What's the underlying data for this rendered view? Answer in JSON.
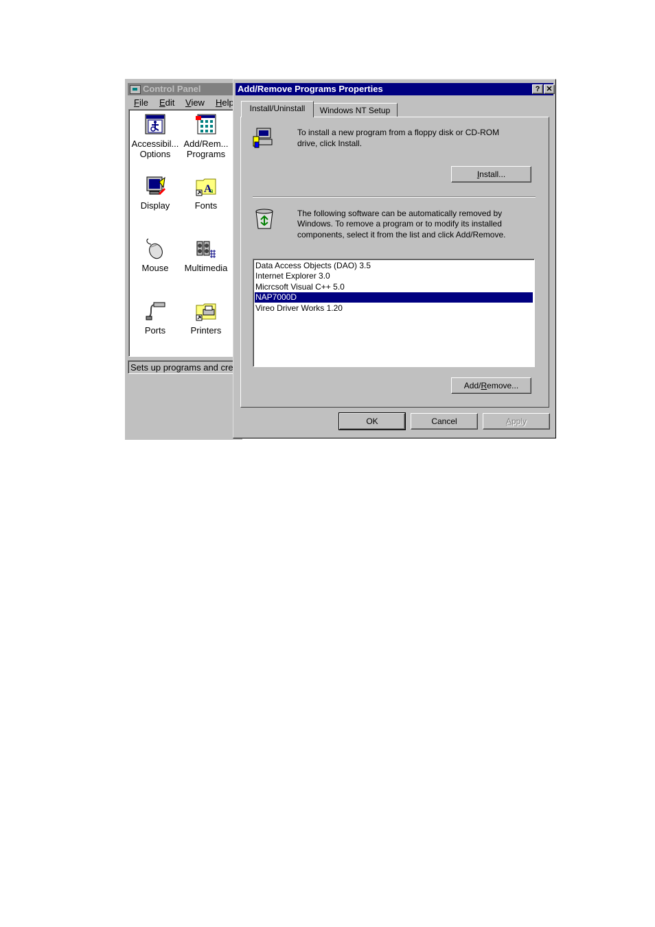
{
  "control_panel": {
    "title": "Control Panel",
    "menu": [
      {
        "label": "File",
        "accel": "F",
        "rest": "ile"
      },
      {
        "label": "Edit",
        "accel": "E",
        "rest": "dit"
      },
      {
        "label": "View",
        "accel": "V",
        "rest": "iew"
      },
      {
        "label": "Help",
        "accel": "H",
        "rest": "elp"
      }
    ],
    "items": [
      {
        "line1": "Accessibil...",
        "line2": "Options",
        "icon": "accessibility-icon"
      },
      {
        "line1": "Add/Rem...",
        "line2": "Programs",
        "icon": "add-remove-programs-icon"
      },
      {
        "line1": "Display",
        "line2": "",
        "icon": "display-icon"
      },
      {
        "line1": "Fonts",
        "line2": "",
        "icon": "fonts-folder-icon"
      },
      {
        "line1": "Mouse",
        "line2": "",
        "icon": "mouse-icon"
      },
      {
        "line1": "Multimedia",
        "line2": "",
        "icon": "multimedia-icon"
      },
      {
        "line1": "Ports",
        "line2": "",
        "icon": "ports-icon"
      },
      {
        "line1": "Printers",
        "line2": "",
        "icon": "printers-folder-icon"
      }
    ],
    "status": "Sets up programs and cre"
  },
  "dialog": {
    "title": "Add/Remove Programs Properties",
    "help_glyph": "?",
    "close_glyph": "✕",
    "tabs": [
      {
        "label": "Install/Uninstall",
        "active": true
      },
      {
        "label": "Windows NT Setup",
        "active": false
      }
    ],
    "install_text_1": "To install a new program from a floppy disk or CD-ROM",
    "install_text_2": "drive, click Install.",
    "install_button": {
      "pre": "",
      "accel": "I",
      "post": "nstall..."
    },
    "remove_text_1": "The following software can be automatically removed by",
    "remove_text_2": "Windows. To remove a program or to modify its installed",
    "remove_text_3": "components, select it from the list and click Add/Remove.",
    "programs": [
      "Data Access Objects (DAO) 3.5",
      "Internet Explorer 3.0",
      "Micrcsoft Visual C++ 5.0",
      "NAP7000D",
      "Vireo Driver Works 1.20"
    ],
    "selected_index": 3,
    "add_remove_button": {
      "pre": "Add/",
      "accel": "R",
      "post": "emove..."
    },
    "ok_label": "OK",
    "cancel_label": "Cancel",
    "apply_button": {
      "pre": "",
      "accel": "A",
      "post": "pply"
    }
  },
  "colors": {
    "face": "#c0c0c0",
    "active_title": "#000080",
    "inactive_title": "#808080",
    "selection": "#000080"
  }
}
